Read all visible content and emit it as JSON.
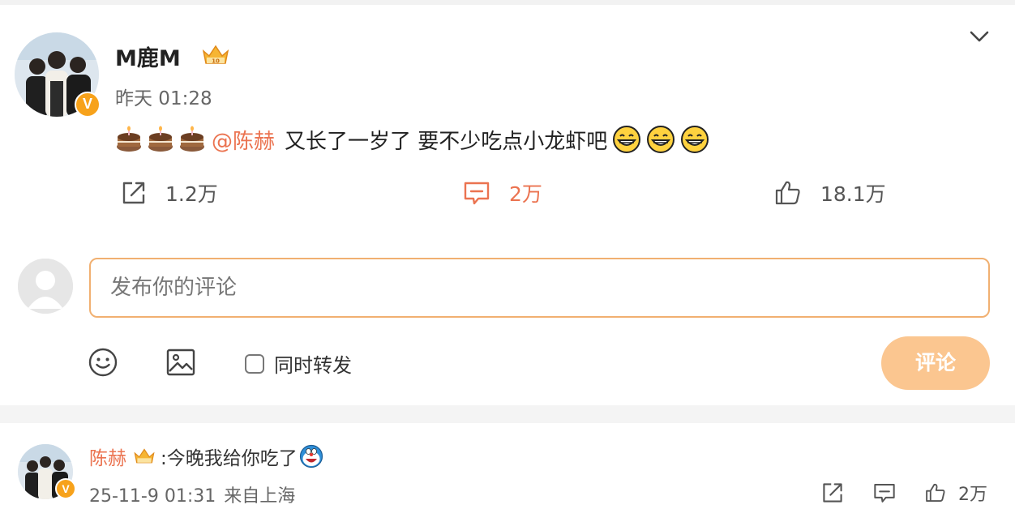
{
  "post": {
    "author": "M鹿M",
    "timestamp": "昨天 01:28",
    "mention": "@陈赫",
    "text": "又长了一岁了 要不少吃点小龙虾吧",
    "cake_icon": "cake-emoji-icon",
    "grin_icon": "grinning-emoji-icon",
    "repost_count": "1.2万",
    "comment_count": "2万",
    "like_count": "18.1万"
  },
  "composer": {
    "placeholder": "发布你的评论",
    "forward_label": "同时转发",
    "submit_label": "评论"
  },
  "reply": {
    "author": "陈赫",
    "text": ":今晚我给你吃了",
    "date": "25-11-9 01:31",
    "location": "来自上海",
    "like_count": "2万"
  },
  "colors": {
    "accent": "#eb7350",
    "badge": "#f7a21b",
    "input_border": "#f1b071",
    "button_disabled": "#fbc690"
  }
}
